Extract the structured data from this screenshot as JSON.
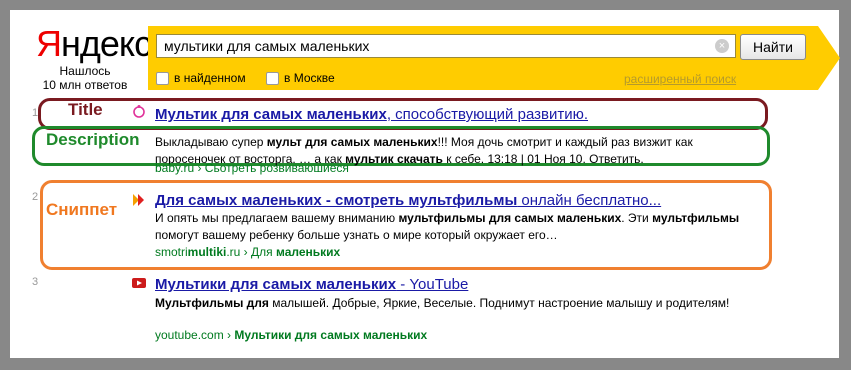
{
  "logo": {
    "first": "Я",
    "rest": "ндекс"
  },
  "found": {
    "line1": "Нашлось",
    "line2": "10 млн ответов"
  },
  "search": {
    "query": "мультики для самых маленьких",
    "clear": "×",
    "button": "Найти",
    "adv": "расширенный поиск"
  },
  "filters": [
    {
      "label": "в найденном"
    },
    {
      "label": "в Москве"
    }
  ],
  "annotations": {
    "title": "Title",
    "description": "Description",
    "snippet": "Сниппет"
  },
  "results": [
    {
      "rank": "1",
      "title_bold": "Мультик для самых маленьких",
      "title_rest": ", способствующий развитию.",
      "snippet_html": "Выкладываю супер <b>мульт для самых маленьких</b>!!! Моя дочь смотрит и каждый раз визжит как поросеночек от восторга. … а как <b>мультик скачать</b> к себе. 13:18 | 01 Ноя 10. Ответить.",
      "url": "baby.ru › Сьотреть розвиваюшиеся"
    },
    {
      "rank": "2",
      "title_bold": "Для самых маленьких - смотреть мультфильмы",
      "title_rest": " онлайн бесплатно...",
      "snippet_html": "И опять мы предлагаем вашему вниманию <b>мультфильмы для самых маленьких</b>. Эти <b>мультфильмы</b> помогут вашему ребенку больше узнать о мире который окружает его…",
      "url_a": "smotri",
      "url_b": "multiki",
      "url_c": ".ru › Для ",
      "url_d": "маленьких"
    },
    {
      "rank": "3",
      "title_bold": "Мультики для самых маленьких",
      "title_rest": " - YouTube",
      "snippet_html": "<b>Мультфильмы для</b> малышей. Добрые, Яркие, Веселые. Поднимут настроение малышу и родителям!",
      "url_a": "youtube.com › ",
      "url_b": "Мультики для самых маленьких"
    }
  ],
  "colors": {
    "accent": "#ffcc00",
    "link": "#1a1aa6",
    "url": "#007a1f",
    "title_box": "#7a1a20",
    "desc_box": "#1f8a2c",
    "snippet_box": "#f08030"
  }
}
